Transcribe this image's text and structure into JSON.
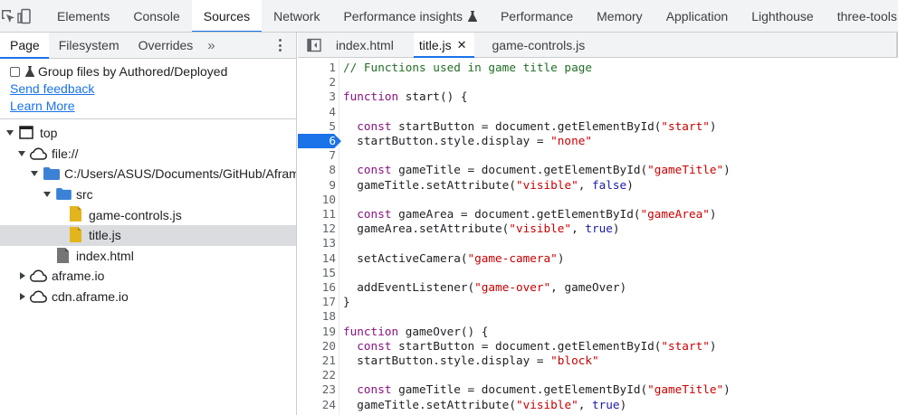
{
  "devtools_tabs": [
    "Elements",
    "Console",
    "Sources",
    "Network",
    "Performance insights",
    "Performance",
    "Memory",
    "Application",
    "Lighthouse",
    "three-tools"
  ],
  "active_devtools_tab": "Sources",
  "navigator": {
    "tabs": [
      "Page",
      "Filesystem",
      "Overrides"
    ],
    "more": "»",
    "group_option_label": "Group files by Authored/Deployed",
    "group_option_checked": false,
    "send_feedback": "Send feedback",
    "learn_more": "Learn More",
    "tree": {
      "top": "top",
      "origin": "file://",
      "folder_path": "C:/Users/ASUS/Documents/GitHub/Aframe",
      "src": "src",
      "game_controls": "game-controls.js",
      "title": "title.js",
      "index": "index.html",
      "aframe_io": "aframe.io",
      "cdn_aframe_io": "cdn.aframe.io"
    }
  },
  "editor": {
    "tabs": [
      {
        "label": "index.html"
      },
      {
        "label": "title.js",
        "close": "✕"
      },
      {
        "label": "game-controls.js"
      }
    ],
    "active_tab": "title.js",
    "breakpoint_line": 6,
    "lines": [
      {
        "n": "1",
        "t": "// Functions used in game title page"
      },
      {
        "n": "2",
        "t": ""
      },
      {
        "n": "3",
        "t": "function start() {"
      },
      {
        "n": "4",
        "t": ""
      },
      {
        "n": "5",
        "t": "  const startButton = document.getElementById(\"start\")"
      },
      {
        "n": "6",
        "t": "  startButton.style.display = \"none\""
      },
      {
        "n": "7",
        "t": ""
      },
      {
        "n": "8",
        "t": "  const gameTitle = document.getElementById(\"gameTitle\")"
      },
      {
        "n": "9",
        "t": "  gameTitle.setAttribute(\"visible\", false)"
      },
      {
        "n": "10",
        "t": ""
      },
      {
        "n": "11",
        "t": "  const gameArea = document.getElementById(\"gameArea\")"
      },
      {
        "n": "12",
        "t": "  gameArea.setAttribute(\"visible\", true)"
      },
      {
        "n": "13",
        "t": ""
      },
      {
        "n": "14",
        "t": "  setActiveCamera(\"game-camera\")"
      },
      {
        "n": "15",
        "t": ""
      },
      {
        "n": "16",
        "t": "  addEventListener(\"game-over\", gameOver)"
      },
      {
        "n": "17",
        "t": "}"
      },
      {
        "n": "18",
        "t": ""
      },
      {
        "n": "19",
        "t": "function gameOver() {"
      },
      {
        "n": "20",
        "t": "  const startButton = document.getElementById(\"start\")"
      },
      {
        "n": "21",
        "t": "  startButton.style.display = \"block\""
      },
      {
        "n": "22",
        "t": ""
      },
      {
        "n": "23",
        "t": "  const gameTitle = document.getElementById(\"gameTitle\")"
      },
      {
        "n": "24",
        "t": "  gameTitle.setAttribute(\"visible\", true)"
      }
    ]
  },
  "colors": {
    "accent": "#1a73e8",
    "folder": "#3b82d6",
    "js_file": "#e3b51c",
    "html_file": "#757575",
    "keyword": "#881280",
    "string": "#c80000",
    "comment": "#236e25"
  },
  "icons": [
    "inspect-element-icon",
    "device-toolbar-icon",
    "flask-icon",
    "more-vert-icon",
    "toggle-navigator-icon",
    "frame-icon",
    "cloud-icon",
    "folder-icon",
    "file-icon"
  ]
}
